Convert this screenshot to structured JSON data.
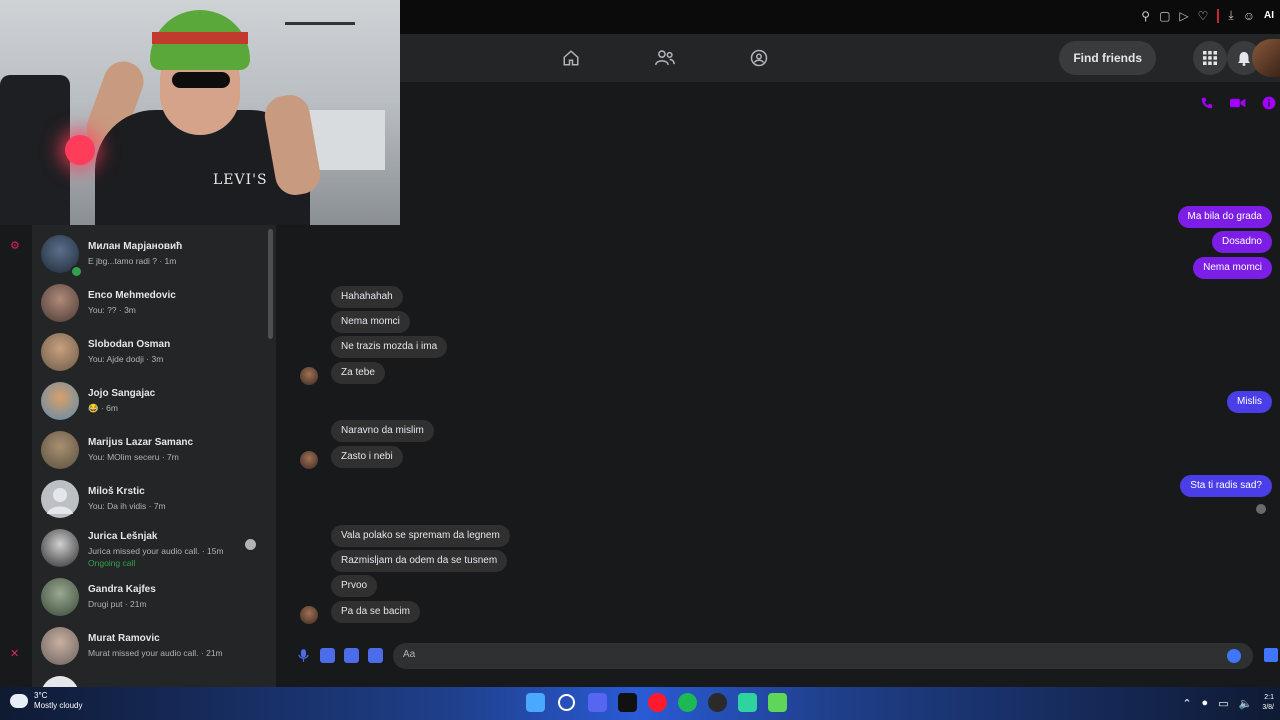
{
  "nav": {
    "find_friends_label": "Find friends"
  },
  "browser": {
    "ai_label": "AI"
  },
  "conversations": [
    {
      "name": "Милан Марјановић",
      "preview": "E jbg...tamo radi ? · 1m",
      "online": true
    },
    {
      "name": "Enco Mehmedovic",
      "preview": "You: ?? · 3m"
    },
    {
      "name": "Slobodan Osman",
      "preview": "You: Ajde dodji · 3m"
    },
    {
      "name": "Jojo Sangajac",
      "preview": "😂 · 6m"
    },
    {
      "name": "Marijus Lazar Samanc",
      "preview": "You: MOlim seceru · 7m"
    },
    {
      "name": "Miloš Krstic",
      "preview": "You: Da ih vidis · 7m"
    },
    {
      "name": "Jurica Lešnjak",
      "preview": "Jurica missed your audio call. · 15m",
      "extra": "Ongoing call"
    },
    {
      "name": "Gandra Kajfes",
      "preview": "Drugi put · 21m"
    },
    {
      "name": "Murat Ramovic",
      "preview": "Murat missed your audio call. · 21m"
    }
  ],
  "messages": {
    "out1": "Ma bila do grada",
    "out2": "Dosadno",
    "out3": "Nema momci",
    "in1": "Hahahahah",
    "in2": "Nema momci",
    "in3": "Ne trazis mozda i ima",
    "in4": "Za tebe",
    "out4": "Mislis",
    "in5": "Naravno da mislim",
    "in6": "Zasto i nebi",
    "out5": "Sta ti radis sad?",
    "in7": "Vala polako se spremam da legnem",
    "in8": "Razmisljam da odem da se tusnem",
    "in9": "Prvoo",
    "in10": "Pa da se bacim"
  },
  "composer": {
    "placeholder": "Aa"
  },
  "taskbar": {
    "temperature": "3°C",
    "weather": "Mostly cloudy",
    "time": "2:1",
    "date": "3/8/"
  },
  "webcam": {
    "shirt_logo": "LEVI'S"
  },
  "colors": {
    "outgoing_purple": "#7c1ee6",
    "outgoing_blue": "#4a3ee8",
    "accent": "#a200ff",
    "online_green": "#31a24c"
  }
}
